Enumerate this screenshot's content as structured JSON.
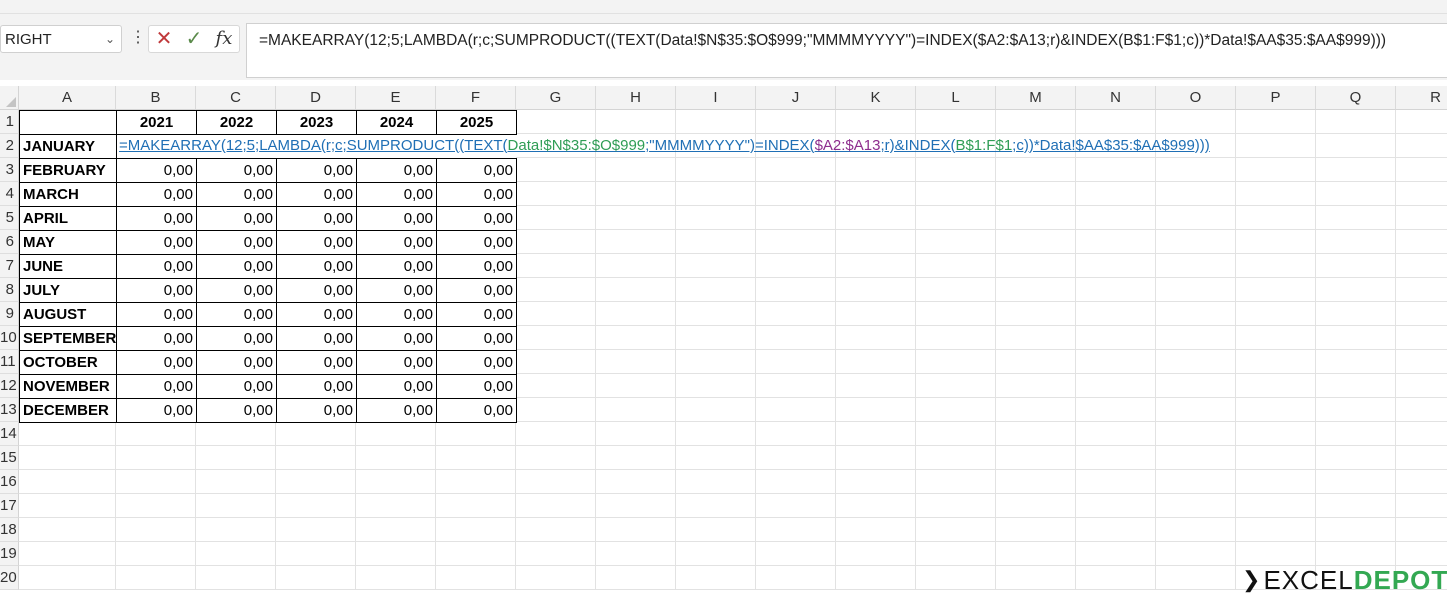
{
  "name_box": {
    "value": "RIGHT",
    "dropdown_icon": "chevron-down-icon"
  },
  "formula_buttons": {
    "cancel": "✕",
    "enter": "✓",
    "fx": "fx"
  },
  "formula": "=MAKEARRAY(12;5;LAMBDA(r;c;SUMPRODUCT((TEXT(Data!$N$35:$O$999;\"MMMMYYYY\")=INDEX($A2:$A13;r)&INDEX(B$1:F$1;c))*Data!$AA$35:$AA$999)))",
  "edit_parts": [
    "=MAKEARRAY(12;5;LAMBDA(r;c;SUMPRODUCT((TEXT(",
    "Data!$N$35:$O$999",
    ";\"MMMMYYYY\")=INDEX(",
    "$A2:$A13",
    ";r)&INDEX(",
    "B$1:F$1",
    ";c))*Data!$AA$35:$AA$999)))"
  ],
  "columns": [
    "A",
    "B",
    "C",
    "D",
    "E",
    "F",
    "G",
    "H",
    "I",
    "J",
    "K",
    "L",
    "M",
    "N",
    "O",
    "P",
    "Q",
    "R"
  ],
  "rows": [
    "1",
    "2",
    "3",
    "4",
    "5",
    "6",
    "7",
    "8",
    "9",
    "10",
    "11",
    "12",
    "13",
    "14",
    "15",
    "16",
    "17",
    "18",
    "19",
    "20"
  ],
  "years": [
    "2021",
    "2022",
    "2023",
    "2024",
    "2025"
  ],
  "months": [
    "JANUARY",
    "FEBRUARY",
    "MARCH",
    "APRIL",
    "MAY",
    "JUNE",
    "JULY",
    "AUGUST",
    "SEPTEMBER",
    "OCTOBER",
    "NOVEMBER",
    "DECEMBER"
  ],
  "cell_value": "0,00",
  "logo": {
    "text1": "EXCEL",
    "text2": "DEPOT"
  }
}
